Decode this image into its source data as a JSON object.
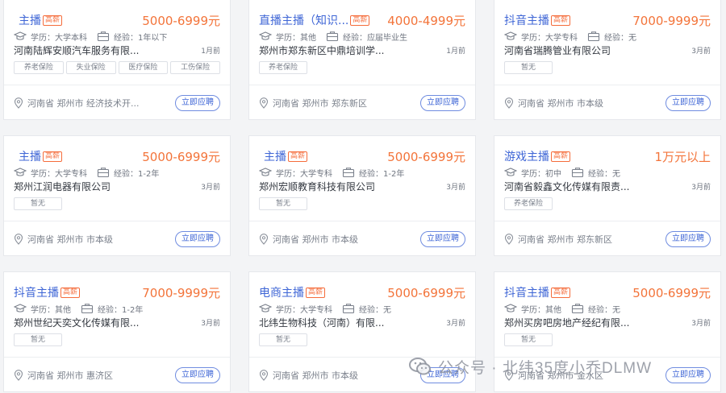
{
  "meta_labels": {
    "education_prefix": "学历：",
    "experience_prefix": "经验："
  },
  "apply_label": "立即应聘",
  "colors": {
    "title": "#3f66d6",
    "salary": "#f3743a",
    "badge": "#f56c3b"
  },
  "cards": [
    {
      "title": "主播",
      "badge": "高薪",
      "salary": "5000-6999元",
      "education": "大学本科",
      "experience": "1年以下",
      "company": "河南陆辉安顺汽车服务有限...",
      "time": "1月前",
      "tags": [
        "养老保险",
        "失业保险",
        "医疗保险",
        "工伤保险"
      ],
      "location": "河南省 郑州市 经济技术开..."
    },
    {
      "title": "直播主播（知识...",
      "badge": "高薪",
      "salary": "4000-4999元",
      "education": "其他",
      "experience": "应届毕业生",
      "company": "郑州市郑东新区中鼎培训学...",
      "time": "1月前",
      "tags": [
        "养老保险"
      ],
      "location": "河南省 郑州市 郑东新区"
    },
    {
      "title": "抖音主播",
      "badge": "高薪",
      "salary": "7000-9999元",
      "education": "大学专科",
      "experience": "无",
      "company": "河南省瑞腾管业有限公司",
      "time": "3月前",
      "tags": [
        "暂无"
      ],
      "location": "河南省 郑州市 市本级"
    },
    {
      "title": "主播",
      "badge": "高薪",
      "salary": "5000-6999元",
      "education": "大学专科",
      "experience": "1-2年",
      "company": "郑州江润电器有限公司",
      "time": "3月前",
      "tags": [
        "暂无"
      ],
      "location": "河南省 郑州市 市本级"
    },
    {
      "title": "主播",
      "badge": "高薪",
      "salary": "5000-6999元",
      "education": "大学专科",
      "experience": "1-2年",
      "company": "郑州宏顺教育科技有限公司",
      "time": "3月前",
      "tags": [
        "暂无"
      ],
      "location": "河南省 郑州市 市本级"
    },
    {
      "title": "游戏主播",
      "badge": "高薪",
      "salary": "1万元以上",
      "education": "初中",
      "experience": "无",
      "company": "河南省毅鑫文化传媒有限责...",
      "time": "3月前",
      "tags": [
        "养老保险"
      ],
      "location": "河南省 郑州市 郑东新区"
    },
    {
      "title": "抖音主播",
      "badge": "高薪",
      "salary": "7000-9999元",
      "education": "其他",
      "experience": "1-2年",
      "company": "郑州世纪天奕文化传媒有限...",
      "time": "3月前",
      "tags": [
        "暂无"
      ],
      "location": "河南省 郑州市 惠济区"
    },
    {
      "title": "电商主播",
      "badge": "高薪",
      "salary": "5000-6999元",
      "education": "大学专科",
      "experience": "无",
      "company": "北纬生物科技（河南）有限...",
      "time": "3月前",
      "tags": [
        "暂无"
      ],
      "location": "河南省 郑州市 市本级"
    },
    {
      "title": "抖音主播",
      "badge": "高薪",
      "salary": "5000-6999元",
      "education": "其他",
      "experience": "无",
      "company": "郑州买房吧房地产经纪有限...",
      "time": "3月前",
      "tags": [
        "暂无"
      ],
      "location": "河南省 郑州市 金水区"
    }
  ],
  "watermark": {
    "text": "公众号 · 北纬35度小乔DLMW",
    "icon": "wechat-icon"
  }
}
